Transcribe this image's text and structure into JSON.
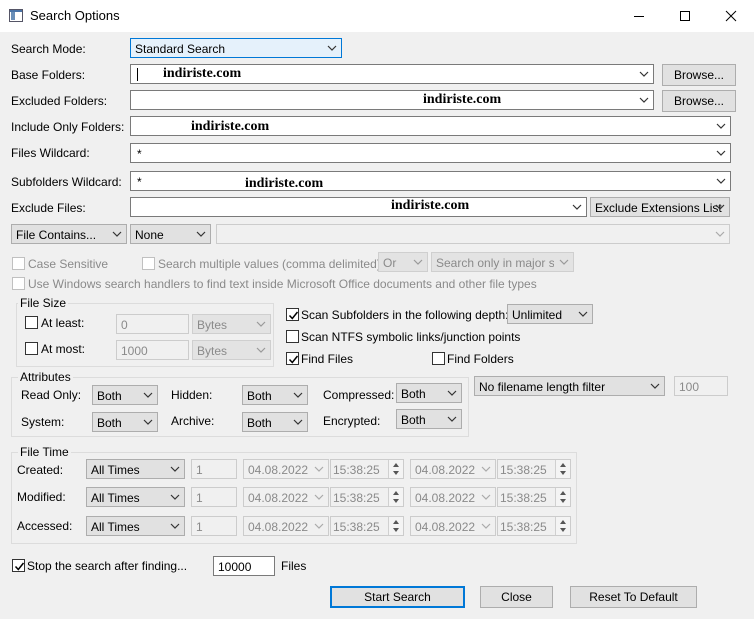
{
  "window": {
    "title": "Search Options"
  },
  "search_mode": {
    "label": "Search Mode:",
    "value": "Standard Search"
  },
  "base_folders": {
    "label": "Base Folders:",
    "value": "",
    "browse": "Browse..."
  },
  "excluded_folders": {
    "label": "Excluded Folders:",
    "value": "",
    "browse": "Browse..."
  },
  "include_only_folders": {
    "label": "Include Only Folders:",
    "value": ""
  },
  "files_wildcard": {
    "label": "Files Wildcard:",
    "value": "*"
  },
  "subfolders_wildcard": {
    "label": "Subfolders Wildcard:",
    "value": "*"
  },
  "exclude_files": {
    "label": "Exclude Files:",
    "value": "",
    "list_label": "Exclude Extensions List"
  },
  "watermark": "indiriste.com",
  "content_search": {
    "type": "File Contains...",
    "encoding": "None",
    "text": ""
  },
  "options": {
    "case_sensitive": "Case Sensitive",
    "multiple_values": "Search multiple values (comma delimited)",
    "logic": "Or",
    "stream": "Search only in major stre",
    "windows_handlers": "Use Windows search handlers to find text inside Microsoft Office documents and other file types"
  },
  "file_size": {
    "title": "File Size",
    "at_least_label": "At least:",
    "at_least_value": "0",
    "at_least_unit": "Bytes",
    "at_most_label": "At most:",
    "at_most_value": "1000",
    "at_most_unit": "Bytes"
  },
  "scan": {
    "subfolders_label": "Scan Subfolders in the following depth:",
    "subfolders_checked": true,
    "depth": "Unlimited",
    "ntfs_label": "Scan NTFS symbolic links/junction points",
    "ntfs_checked": false,
    "find_files_label": "Find Files",
    "find_files_checked": true,
    "find_folders_label": "Find Folders",
    "find_folders_checked": false
  },
  "attributes": {
    "title": "Attributes",
    "read_only_label": "Read Only:",
    "read_only": "Both",
    "hidden_label": "Hidden:",
    "hidden": "Both",
    "compressed_label": "Compressed:",
    "compressed": "Both",
    "system_label": "System:",
    "system": "Both",
    "archive_label": "Archive:",
    "archive": "Both",
    "encrypted_label": "Encrypted:",
    "encrypted": "Both"
  },
  "filename_filter": {
    "value": "No filename length filter",
    "length": "100"
  },
  "file_time": {
    "title": "File Time",
    "rows": [
      {
        "label": "Created:",
        "mode": "All Times",
        "count": "1",
        "date1": "04.08.2022",
        "time1": "15:38:25",
        "date2": "04.08.2022",
        "time2": "15:38:25"
      },
      {
        "label": "Modified:",
        "mode": "All Times",
        "count": "1",
        "date1": "04.08.2022",
        "time1": "15:38:25",
        "date2": "04.08.2022",
        "time2": "15:38:25"
      },
      {
        "label": "Accessed:",
        "mode": "All Times",
        "count": "1",
        "date1": "04.08.2022",
        "time1": "15:38:25",
        "date2": "04.08.2022",
        "time2": "15:38:25"
      }
    ]
  },
  "stop_search": {
    "label": "Stop the search after finding...",
    "checked": true,
    "value": "10000",
    "suffix": "Files"
  },
  "buttons": {
    "start": "Start Search",
    "close": "Close",
    "reset": "Reset To Default"
  }
}
